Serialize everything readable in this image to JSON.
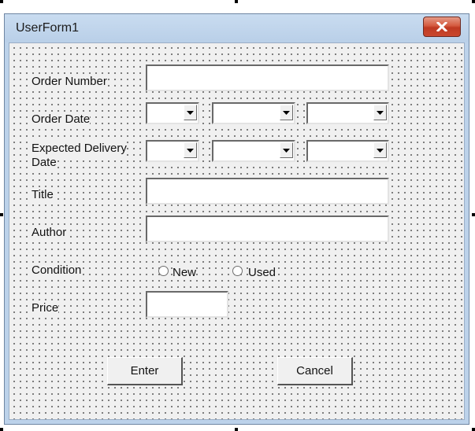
{
  "window": {
    "title": "UserForm1",
    "close_icon": "close-icon",
    "close_color": "#c9472e"
  },
  "form": {
    "order_number_label": "Order Number",
    "order_date_label": "Order Date",
    "expected_delivery_label_line1": "Expected Delivery",
    "expected_delivery_label_line2": "Date",
    "title_label": "Title",
    "author_label": "Author",
    "condition_label": "Condition",
    "condition_options": [
      "New",
      "Used"
    ],
    "price_label": "Price",
    "dropdown_icon": "dropdown-arrow-icon"
  },
  "buttons": {
    "enter_label": "Enter",
    "cancel_label": "Cancel"
  }
}
